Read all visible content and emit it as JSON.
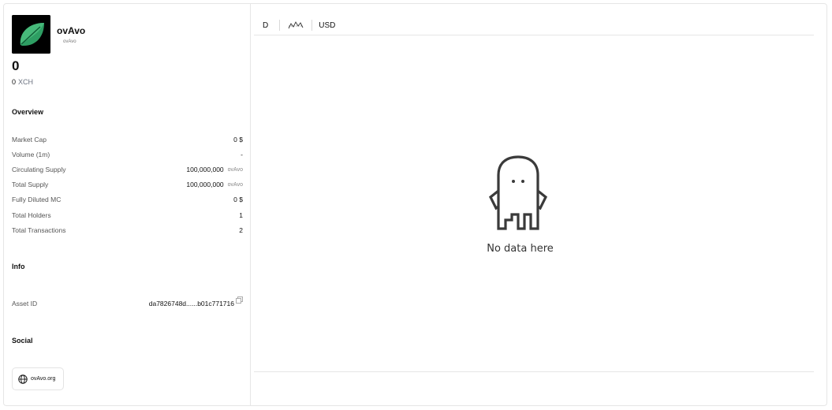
{
  "token": {
    "name": "ovAvo",
    "ticker": "ovAvo",
    "price_usd": "0",
    "price_xch_value": "0",
    "price_xch_unit": "XCH",
    "logo_icon": "leaf-icon",
    "logo_bg": "#000000",
    "logo_leaf_color": "#2e9e63"
  },
  "overview": {
    "title": "Overview",
    "rows": [
      {
        "label": "Market Cap",
        "value": "0 $",
        "unit": ""
      },
      {
        "label": "Volume (1m)",
        "value": "-",
        "unit": ""
      },
      {
        "label": "Circulating Supply",
        "value": "100,000,000",
        "unit": "ovAvo"
      },
      {
        "label": "Total Supply",
        "value": "100,000,000",
        "unit": "ovAvo"
      },
      {
        "label": "Fully Diluted MC",
        "value": "0 $",
        "unit": ""
      },
      {
        "label": "Total Holders",
        "value": "1",
        "unit": ""
      },
      {
        "label": "Total Transactions",
        "value": "2",
        "unit": ""
      }
    ]
  },
  "info": {
    "title": "Info",
    "asset_id_label": "Asset ID",
    "asset_id_value": "da7826748d......b01c771716"
  },
  "social": {
    "title": "Social",
    "website_label": "ovAvo.org",
    "website_icon": "globe-icon"
  },
  "chart_toolbar": {
    "interval": "D",
    "indicator_icon": "indicators-icon",
    "currency": "USD"
  },
  "chart_empty": {
    "message": "No data here",
    "icon": "ghost-icon"
  }
}
